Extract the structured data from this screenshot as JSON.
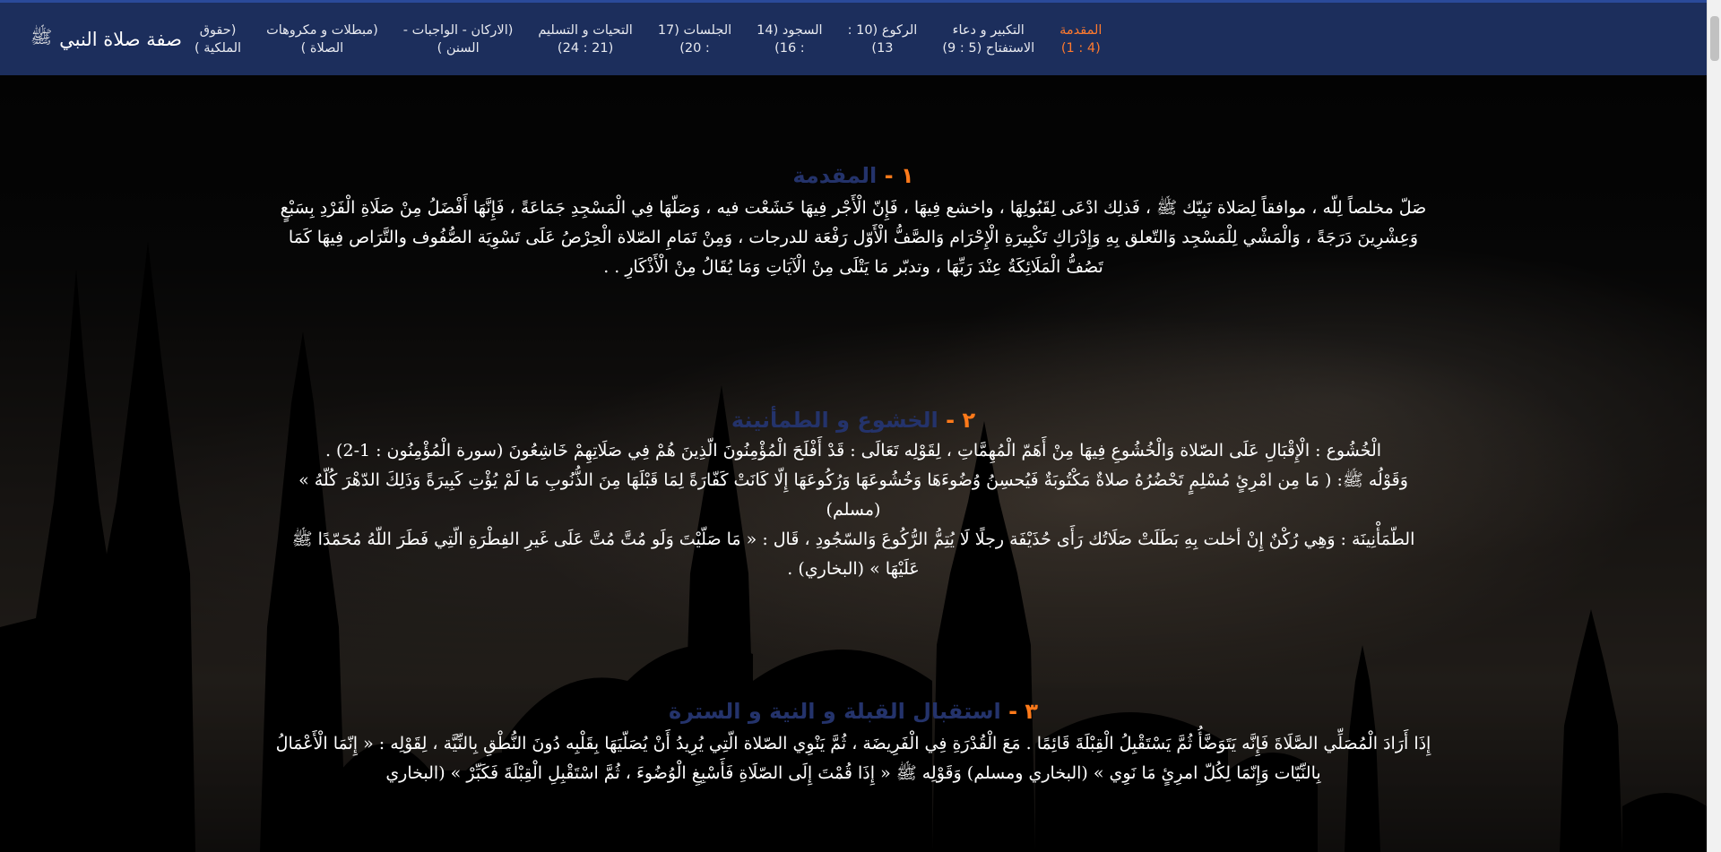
{
  "navbar": {
    "brand": "صفة صلاة النبي",
    "brand_seal": "ﷺ",
    "items": [
      {
        "line1": "المقدمة",
        "line2": "(4 : 1)",
        "active": true
      },
      {
        "line1": "التكبير و دعاء",
        "line2": "الاستفتاح (5 : 9)",
        "active": false
      },
      {
        "line1": "الركوع (10 :",
        "line2": "13)",
        "active": false
      },
      {
        "line1": "السجود (14",
        "line2": ": 16)",
        "active": false
      },
      {
        "line1": "الجلسات (17",
        "line2": ": 20)",
        "active": false
      },
      {
        "line1": "التحيات و التسليم",
        "line2": "(21 : 24)",
        "active": false
      },
      {
        "line1": "(الاركان - الواجبات -",
        "line2": "السنن )",
        "active": false
      },
      {
        "line1": "(مبطلات و مكروهات",
        "line2": "الصلاة )",
        "active": false
      },
      {
        "line1": "(حقوق",
        "line2": "الملكية )",
        "active": false
      }
    ]
  },
  "sections": [
    {
      "number": "١ -",
      "title": "المقدمة",
      "text": "صَلّ مخلصاً لِلّه ، موافقاً لِصَلاة نَبِيّك ﷺ ، فَذلِك ادْعَى لِقَبُولِهَا ، واخشع فِيهَا ، فَإِنّ الْأَجْر فِيهَا خَشَعْت فيه ، وَصَلّهَا فِي الْمَسْجِدِ جَمَاعَةً ، فَإِنَّهَا أَفْضَلُ مِنْ صَلَاةِ الْفَرْدِ بِسَبْعٍ وَعِشْرِينَ دَرَجَةً ، وَالْمَشْي لِلْمَسْجِد وَالتّعلق بِهِ وَإِدْرَاكِ تَكْبِيرَةِ الْإِحْرَام وَالصَّفُّ الْأَوّل رَفْعَة للدرجات ، وَمِنْ تَمَامِ الصّلاة الْحِرْصُ عَلَى تَسْوِيَة الصُّفُوف والتَّرَاص فِيهَا كَمَا تَصُفُّ الْمَلَائِكَةُ عِنْدَ رَبِّهَا ، وتدبّر مَا يَتْلَى مِنْ الْآيَاتِ وَمَا يُقَالُ مِنْ الْأَذْكَارِ . ."
    },
    {
      "number": "٢ -",
      "title": "الخشوع و الطمأنينة",
      "paragraphs": [
        "الْخُشُوع : الْإِقْبَالِ عَلَى الصّلاة وَالْخُشُوعِ فِيهَا مِنْ أَهَمّ الْمُهِمَّاتِ ، لِقَوْلِه تَعَالَى : قَدْ أَفْلَحَ الْمُؤْمِنُونَ الّذِينَ هُمْ فِي صَلَاتِهِمْ خَاشِعُونَ (سورة الْمُؤْمِنُون : 1-2) .",
        "وَقَوْلُه ﷺ: ( مَا مِن امْرِئٍ مُسْلِمٍ تَحْضُرُهُ صلاةٌ مَكْتُوبَةٌ فَيُحسِنُ وُضُوءَهَا وَخُشُوعَهَا وَرُكُوعَهَا إِلّا كَانَتْ كَفّارَةً لِمَا قَبْلَهَا مِنَ الذُّنُوبِ مَا لَمْ يُؤْتِ كَبِيرَةً وَذَلِكَ الدّهْرَ كُلّهُ » (مسلم)",
        "الطّمَأْنِينَة : وَهِي رُكْنٌ إِنْ أخلت بِهِ بَطَلَتْ صَلَاتُك رَأَى حُذَيْفَة رجلًا لَا يُتِمُّ الرُّكُوعَ وَالسّجُودِ ، قَال : « مَا صَلّيْتَ وَلَو مُتَّ مُتَّ عَلَى غَيرِ الفِطْرَةِ الّتِي فَطَرَ اللّهُ مُحَمّدًا ﷺ عَلَيْهَا » (البخاري) ."
      ]
    },
    {
      "number": "٣ -",
      "title": "استقبال القبلة و النية و السترة",
      "text": "إِذَا أَرَادَ الْمُصَلِّي الصَّلَاةَ فَإِنَّه يَتَوَضَّأُ ثُمَّ يَسْتَقْبِلُ الْقِبْلَةَ قَائِمًا . مَعَ الْقُدْرَةِ فِي الْفَرِيضَة ، ثُمَّ يَنْوِي الصّلاة الّتِي يُرِيدُ أَنْ يُصَلّيَهَا بِقَلْبِه دُونَ النُّطْقِ بِالنِّيَّة ، لِقَوْلِه : « إِنّمَا الْأَعْمَالُ بِالنِّيّات وَإِنّمَا لِكُلّ امرِئٍ مَا نَوِي » (البخاري ومسلم) وَقَوْلِه ﷺ « إِذَا قُمْتَ إِلَى الصّلَاةِ فَأَسْبِغِ الْوُضُوءَ ، ثُمَّ اسْتَقْبِلِ الْقِبْلَةَ فَكَبِّرْ » (البخاري"
    }
  ]
}
